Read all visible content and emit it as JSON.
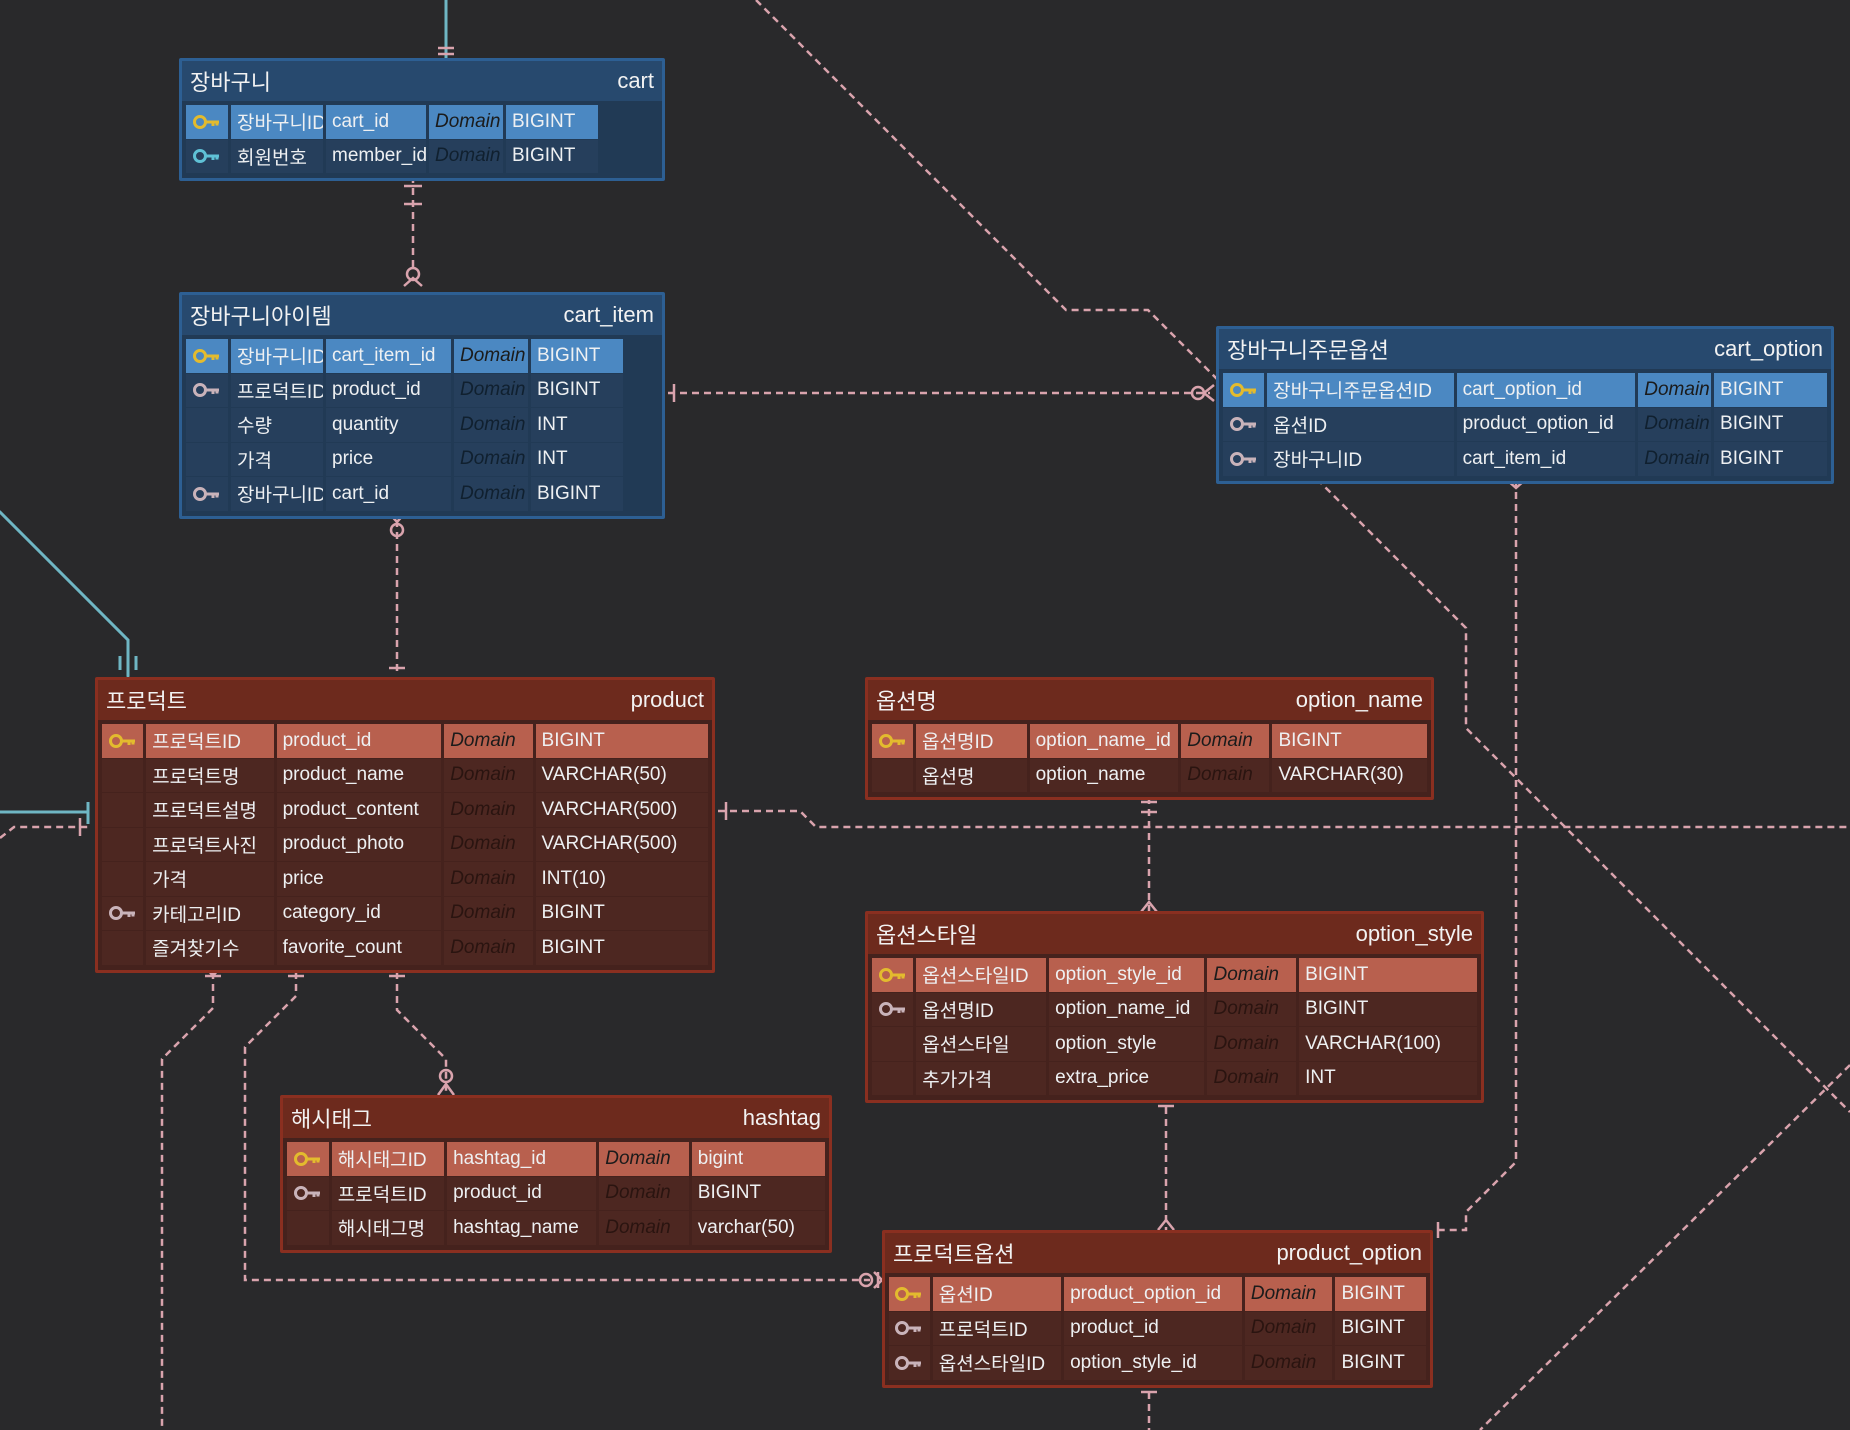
{
  "colors": {
    "background": "#29292b",
    "relationship_line": "#d9a3ad",
    "self_link_line": "#6fb6c4",
    "primary_key_icon": "#e3bb2e",
    "foreign_key_icon": "#c9b3ba",
    "cart_member_key_icon": "#5fc1d6"
  },
  "entities": [
    {
      "id": "cart",
      "logical_name": "장바구니",
      "physical_name": "cart",
      "columns": [
        {
          "key": "pk",
          "logical": "장바구니ID",
          "physical": "cart_id",
          "domain": "Domain",
          "type": "BIGINT"
        },
        {
          "key": "member",
          "logical": "회원번호",
          "physical": "member_id",
          "domain": "Domain",
          "type": "BIGINT"
        }
      ]
    },
    {
      "id": "cart_item",
      "logical_name": "장바구니아이템",
      "physical_name": "cart_item",
      "columns": [
        {
          "key": "pk",
          "logical": "장바구니ID",
          "physical": "cart_item_id",
          "domain": "Domain",
          "type": "BIGINT"
        },
        {
          "key": "fk",
          "logical": "프로덕트ID",
          "physical": "product_id",
          "domain": "Domain",
          "type": "BIGINT"
        },
        {
          "key": "",
          "logical": "수량",
          "physical": "quantity",
          "domain": "Domain",
          "type": "INT"
        },
        {
          "key": "",
          "logical": "가격",
          "physical": "price",
          "domain": "Domain",
          "type": "INT"
        },
        {
          "key": "fk",
          "logical": "장바구니ID",
          "physical": "cart_id",
          "domain": "Domain",
          "type": "BIGINT"
        }
      ]
    },
    {
      "id": "cart_option",
      "logical_name": "장바구니주문옵션",
      "physical_name": "cart_option",
      "columns": [
        {
          "key": "pk",
          "logical": "장바구니주문옵션ID",
          "physical": "cart_option_id",
          "domain": "Domain",
          "type": "BIGINT"
        },
        {
          "key": "fk",
          "logical": "옵션ID",
          "physical": "product_option_id",
          "domain": "Domain",
          "type": "BIGINT"
        },
        {
          "key": "fk",
          "logical": "장바구니ID",
          "physical": "cart_item_id",
          "domain": "Domain",
          "type": "BIGINT"
        }
      ]
    },
    {
      "id": "product",
      "logical_name": "프로덕트",
      "physical_name": "product",
      "columns": [
        {
          "key": "pk",
          "logical": "프로덕트ID",
          "physical": "product_id",
          "domain": "Domain",
          "type": "BIGINT"
        },
        {
          "key": "",
          "logical": "프로덕트명",
          "physical": "product_name",
          "domain": "Domain",
          "type": "VARCHAR(50)"
        },
        {
          "key": "",
          "logical": "프로덕트설명",
          "physical": "product_content",
          "domain": "Domain",
          "type": "VARCHAR(500)"
        },
        {
          "key": "",
          "logical": "프로덕트사진",
          "physical": "product_photo",
          "domain": "Domain",
          "type": "VARCHAR(500)"
        },
        {
          "key": "",
          "logical": "가격",
          "physical": "price",
          "domain": "Domain",
          "type": "INT(10)"
        },
        {
          "key": "fk",
          "logical": "카테고리ID",
          "physical": "category_id",
          "domain": "Domain",
          "type": "BIGINT"
        },
        {
          "key": "",
          "logical": "즐겨찾기수",
          "physical": "favorite_count",
          "domain": "Domain",
          "type": "BIGINT"
        }
      ]
    },
    {
      "id": "option_name",
      "logical_name": "옵션명",
      "physical_name": "option_name",
      "columns": [
        {
          "key": "pk",
          "logical": "옵션명ID",
          "physical": "option_name_id",
          "domain": "Domain",
          "type": "BIGINT"
        },
        {
          "key": "",
          "logical": "옵션명",
          "physical": "option_name",
          "domain": "Domain",
          "type": "VARCHAR(30)"
        }
      ]
    },
    {
      "id": "option_style",
      "logical_name": "옵션스타일",
      "physical_name": "option_style",
      "columns": [
        {
          "key": "pk",
          "logical": "옵션스타일ID",
          "physical": "option_style_id",
          "domain": "Domain",
          "type": "BIGINT"
        },
        {
          "key": "fk",
          "logical": "옵션명ID",
          "physical": "option_name_id",
          "domain": "Domain",
          "type": "BIGINT"
        },
        {
          "key": "",
          "logical": "옵션스타일",
          "physical": "option_style",
          "domain": "Domain",
          "type": "VARCHAR(100)"
        },
        {
          "key": "",
          "logical": "추가가격",
          "physical": "extra_price",
          "domain": "Domain",
          "type": "INT"
        }
      ]
    },
    {
      "id": "hashtag",
      "logical_name": "해시태그",
      "physical_name": "hashtag",
      "columns": [
        {
          "key": "pk",
          "logical": "해시태그ID",
          "physical": "hashtag_id",
          "domain": "Domain",
          "type": "bigint"
        },
        {
          "key": "fk",
          "logical": "프로덕트ID",
          "physical": "product_id",
          "domain": "Domain",
          "type": "BIGINT"
        },
        {
          "key": "",
          "logical": "해시태그명",
          "physical": "hashtag_name",
          "domain": "Domain",
          "type": "varchar(50)"
        }
      ]
    },
    {
      "id": "product_option",
      "logical_name": "프로덕트옵션",
      "physical_name": "product_option",
      "columns": [
        {
          "key": "pk",
          "logical": "옵션ID",
          "physical": "product_option_id",
          "domain": "Domain",
          "type": "BIGINT"
        },
        {
          "key": "fk",
          "logical": "프로덕트ID",
          "physical": "product_id",
          "domain": "Domain",
          "type": "BIGINT"
        },
        {
          "key": "fk",
          "logical": "옵션스타일ID",
          "physical": "option_style_id",
          "domain": "Domain",
          "type": "BIGINT"
        }
      ]
    }
  ]
}
